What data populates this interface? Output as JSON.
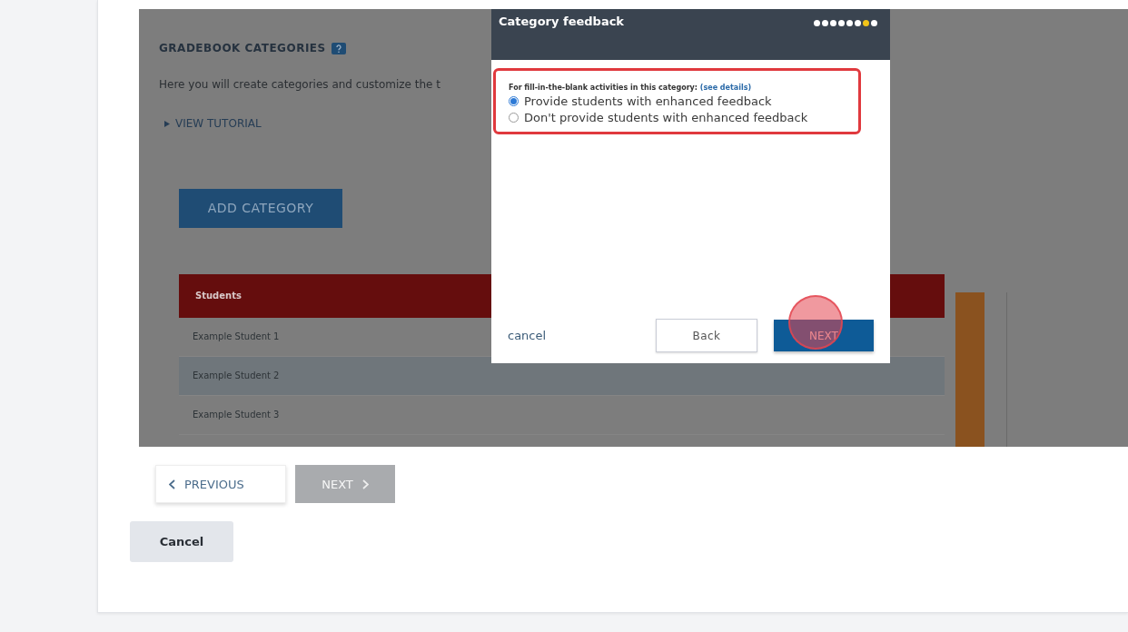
{
  "section": {
    "title": "GRADEBOOK CATEGORIES",
    "description": "Here you will create categories and customize the t",
    "tutorial_link": "VIEW TUTORIAL",
    "add_button": "ADD CATEGORY",
    "table": {
      "header": "Students",
      "rows": [
        "Example Student 1",
        "Example Student 2",
        "Example Student 3"
      ]
    }
  },
  "dialog": {
    "title": "Category feedback",
    "steps": [
      {
        "current": false
      },
      {
        "current": false
      },
      {
        "current": false
      },
      {
        "current": false
      },
      {
        "current": false
      },
      {
        "current": false
      },
      {
        "current": true
      },
      {
        "current": false
      }
    ],
    "prompt": "For fill-in-the-blank activities in this category:",
    "details_link": "(see details)",
    "options": [
      {
        "label": "Provide students with enhanced feedback",
        "selected": true
      },
      {
        "label": "Don't provide students with enhanced feedback",
        "selected": false
      }
    ],
    "cancel": "cancel",
    "back": "Back",
    "next": "NEXT"
  },
  "nav": {
    "previous": "PREVIOUS",
    "next": {
      "label": "NEXT",
      "disabled": true
    }
  },
  "cancel_button": "Cancel"
}
